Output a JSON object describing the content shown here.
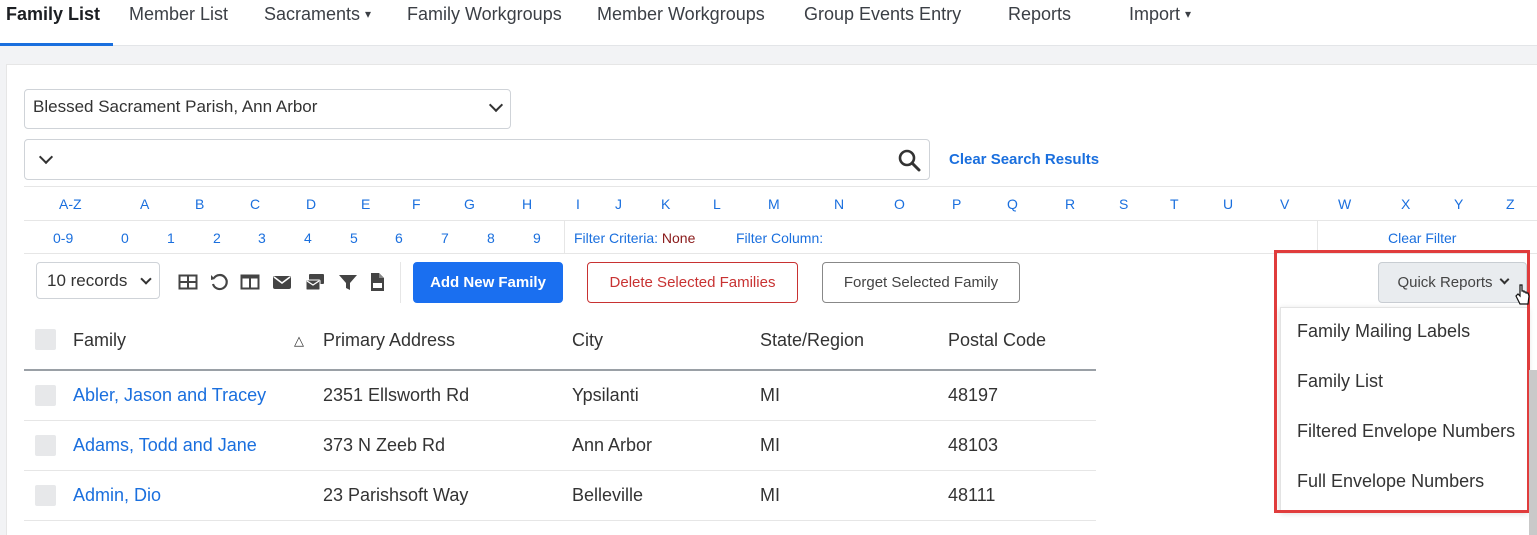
{
  "nav": {
    "items": [
      {
        "label": "Family List",
        "active": true
      },
      {
        "label": "Member List"
      },
      {
        "label": "Sacraments",
        "dropdown": true
      },
      {
        "label": "Family Workgroups"
      },
      {
        "label": "Member Workgroups"
      },
      {
        "label": "Group Events Entry"
      },
      {
        "label": "Reports"
      },
      {
        "label": "Import",
        "dropdown": true
      }
    ],
    "caret": "▾"
  },
  "parish_select": {
    "value": "Blessed Sacrament Parish, Ann Arbor"
  },
  "search": {
    "value": "",
    "icon": "search-icon",
    "clear_label": "Clear Search Results"
  },
  "alphabet": {
    "letters": [
      "A-Z",
      "A",
      "B",
      "C",
      "D",
      "E",
      "F",
      "G",
      "H",
      "I",
      "J",
      "K",
      "L",
      "M",
      "N",
      "O",
      "P",
      "Q",
      "R",
      "S",
      "T",
      "U",
      "V",
      "W",
      "X",
      "Y",
      "Z"
    ],
    "digits": [
      "0-9",
      "0",
      "1",
      "2",
      "3",
      "4",
      "5",
      "6",
      "7",
      "8",
      "9"
    ]
  },
  "filter": {
    "criteria_label": "Filter Criteria:",
    "criteria_value": "None",
    "column_label": "Filter Column:",
    "clear_label": "Clear Filter"
  },
  "toolbar": {
    "records_value": "10 records",
    "icons": [
      "columns-icon",
      "reset-icon",
      "split-view-icon",
      "email-icon",
      "envelope-group-icon",
      "filter-icon",
      "csv-export-icon"
    ],
    "add_label": "Add New Family",
    "delete_label": "Delete Selected Families",
    "forget_label": "Forget Selected Family",
    "quick_reports_label": "Quick Reports"
  },
  "quick_reports_menu": [
    "Family Mailing Labels",
    "Family List",
    "Filtered Envelope Numbers",
    "Full Envelope Numbers"
  ],
  "table": {
    "columns": [
      "Family",
      "Primary Address",
      "City",
      "State/Region",
      "Postal Code"
    ],
    "sort_indicator": "△",
    "rows": [
      [
        "Abler, Jason and Tracey",
        "2351 Ellsworth Rd",
        "Ypsilanti",
        "MI",
        "48197"
      ],
      [
        "Adams, Todd and Jane",
        "373 N Zeeb Rd",
        "Ann Arbor",
        "MI",
        "48103"
      ],
      [
        "Admin, Dio",
        "23 Parishsoft Way",
        "Belleville",
        "MI",
        "48111"
      ]
    ]
  },
  "colors": {
    "accent": "#1a6fde",
    "danger": "#c83232",
    "highlight": "#e03c3c"
  }
}
